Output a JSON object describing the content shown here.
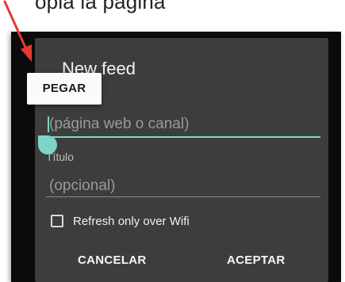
{
  "instruction_text": "opia la página",
  "dialog": {
    "title": "New feed",
    "url_field": {
      "placeholder": "(página web o canal)",
      "value": ""
    },
    "title_field": {
      "label": "Título",
      "placeholder": "(opcional)",
      "value": ""
    },
    "wifi_checkbox": {
      "label": "Refresh only over Wifi",
      "checked": false
    },
    "buttons": {
      "cancel": "CANCELAR",
      "accept": "ACEPTAR"
    }
  },
  "context_menu": {
    "paste": "PEGAR"
  },
  "colors": {
    "accent": "#7fd4c8",
    "dialog_background": "#3d3d3d",
    "annotation_arrow": "#e53935"
  },
  "icons": {
    "annotation": "red-arrow-icon",
    "selection_handle": "text-selection-handle-icon"
  }
}
